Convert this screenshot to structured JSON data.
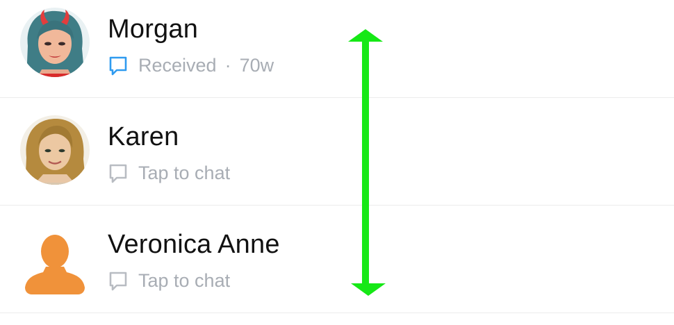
{
  "colors": {
    "received_icon": "#2f9bf0",
    "neutral_icon": "#b8bcc2",
    "status_text": "#a8adb4",
    "name_text": "#111111",
    "arrow": "#16e816",
    "default_avatar": "#f0923a"
  },
  "contacts": [
    {
      "name": "Morgan",
      "status_icon": "chat-bubble-outline-icon",
      "status": "Received",
      "separator": "·",
      "age": "70w",
      "avatar": "bitmoji-avatar"
    },
    {
      "name": "Karen",
      "status_icon": "chat-bubble-outline-icon",
      "status": "Tap to chat",
      "avatar": "bitmoji-avatar"
    },
    {
      "name": "Veronica Anne",
      "status_icon": "chat-bubble-outline-icon",
      "status": "Tap to chat",
      "avatar": "default-silhouette-avatar"
    }
  ],
  "overlay": {
    "icon": "double-headed-vertical-arrow-icon"
  }
}
